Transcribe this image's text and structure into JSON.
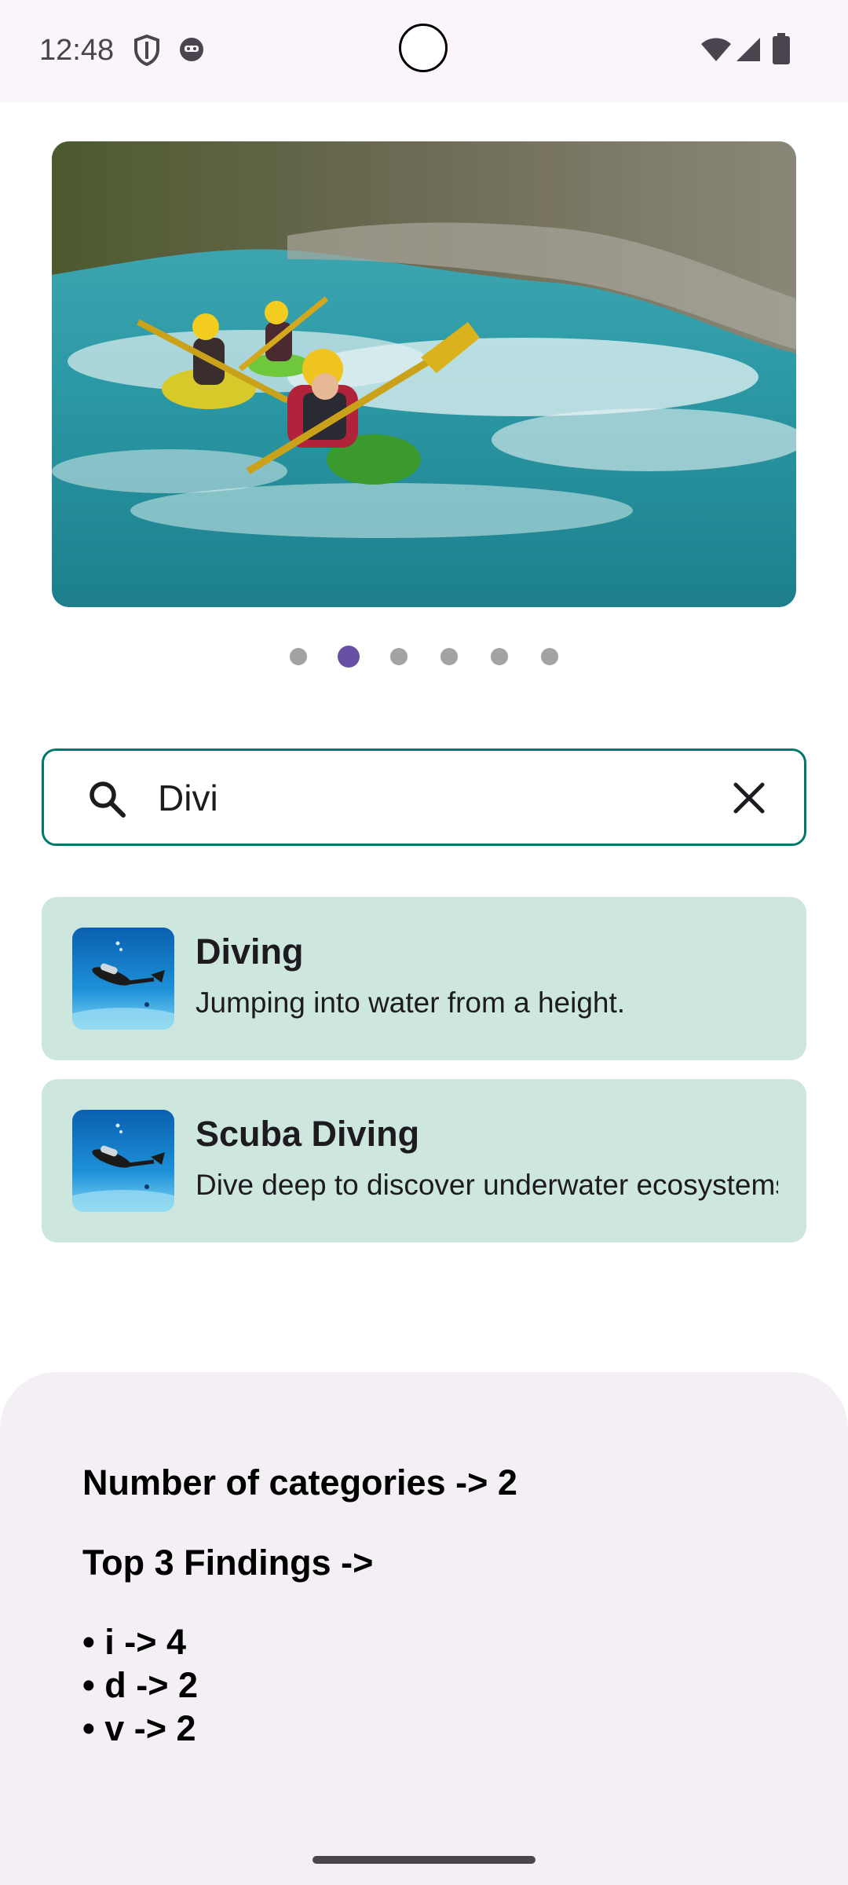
{
  "status_bar": {
    "time": "12:48",
    "left_icons": [
      "shield-icon",
      "cat-face-icon"
    ],
    "right_icons": [
      "wifi-icon",
      "cellular-signal-icon",
      "battery-icon"
    ]
  },
  "carousel": {
    "image_icon": "kayakers-photo",
    "page_count": 6,
    "active_index": 1,
    "active_color": "#6750a4"
  },
  "search": {
    "value": "Divi",
    "icon": "search-icon",
    "clear_icon": "close-icon",
    "border_color": "#00796b"
  },
  "results": [
    {
      "title": "Diving",
      "description": "Jumping into water from a height.",
      "thumbnail": "scuba-diver-photo"
    },
    {
      "title": "Scuba Diving",
      "description": "Dive deep to discover underwater ecosystems.",
      "thumbnail": "scuba-diver-photo"
    }
  ],
  "summary": {
    "categories_text": "Number of categories -> 2",
    "findings_heading": "Top 3 Findings ->",
    "findings": [
      "• i -> 4",
      "• d -> 2",
      "• v -> 2"
    ]
  },
  "colors": {
    "card_background": "#cde7de",
    "sheet_background": "#f3eff4",
    "status_bar_background": "#fcf4fb"
  }
}
